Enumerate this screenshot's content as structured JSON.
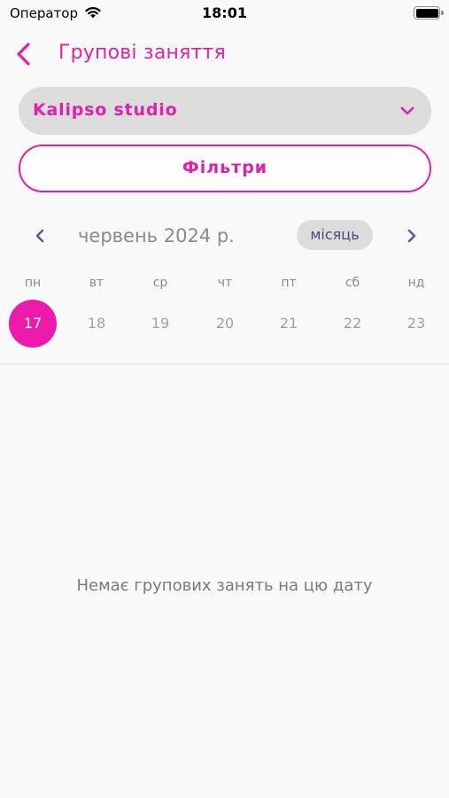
{
  "status_bar": {
    "carrier": "Оператор",
    "time": "18:01"
  },
  "header": {
    "title": "Групові заняття"
  },
  "studio_select": {
    "value": "Kalipso studio"
  },
  "filters": {
    "label": "Фільтри"
  },
  "calendar": {
    "month_label": "червень 2024 р.",
    "view_toggle": "місяць",
    "weekdays": [
      "пн",
      "вт",
      "ср",
      "чт",
      "пт",
      "сб",
      "нд"
    ],
    "days": [
      "17",
      "18",
      "19",
      "20",
      "21",
      "22",
      "23"
    ],
    "selected_day": "17"
  },
  "empty_state": {
    "message": "Немає групових занять на цю дату"
  },
  "colors": {
    "accent": "#e020ac",
    "selected_day": "#ec1bac",
    "select_background": "#dcdcdc",
    "nav_arrow": "#5a5a9a"
  }
}
